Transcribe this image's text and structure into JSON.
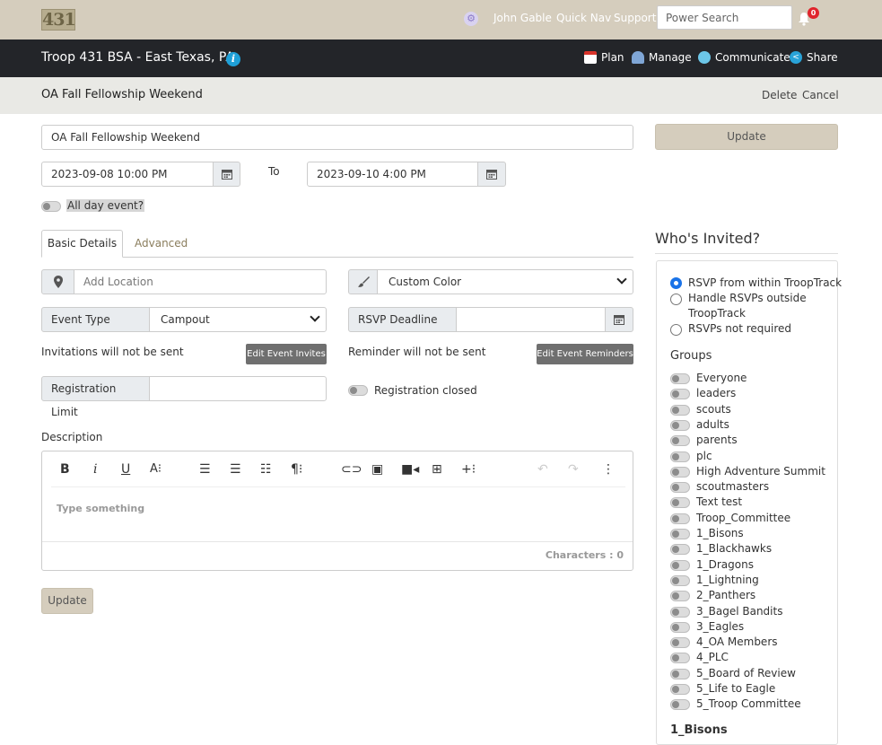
{
  "topbar": {
    "logo": "431",
    "user": "John Gable",
    "quick_nav": "Quick Nav",
    "support": "Support",
    "search_placeholder": "Power Search",
    "notifications_count": "0"
  },
  "troopbar": {
    "troop_name": "Troop 431 BSA - East Texas, PA",
    "nav": [
      {
        "label": "Plan",
        "icon": "calendar-icon"
      },
      {
        "label": "Manage",
        "icon": "people-icon"
      },
      {
        "label": "Communicate",
        "icon": "chat-icon"
      },
      {
        "label": "Share",
        "icon": "share-icon"
      }
    ]
  },
  "titlebar": {
    "title": "OA Fall Fellowship Weekend",
    "delete": "Delete",
    "cancel": "Cancel"
  },
  "form": {
    "event_name": "OA Fall Fellowship Weekend",
    "start": "2023-09-08 10:00 PM",
    "to_label": "To",
    "end": "2023-09-10 4:00 PM",
    "all_day_label": "All day event?",
    "update_label": "Update",
    "tabs": [
      "Basic Details",
      "Advanced"
    ],
    "location_placeholder": "Add Location",
    "color_value": "Custom Color",
    "event_type_label": "Event Type",
    "event_type_value": "Campout",
    "rsvp_deadline_label": "RSVP Deadline",
    "rsvp_deadline_value": "",
    "invites_status": "Invitations will not be sent",
    "edit_invites_label": "Edit Event Invites",
    "reminder_status": "Reminder will not be sent",
    "edit_reminders_label": "Edit Event Reminders",
    "registration_limit_label": "Registration Limit",
    "registration_limit_value": "",
    "registration_closed_label": "Registration closed",
    "description_label": "Description",
    "editor_placeholder": "Type something",
    "characters_label": "Characters : 0"
  },
  "invited": {
    "title": "Who's Invited?",
    "rsvp_options": [
      {
        "label": "RSVP from within TroopTrack",
        "checked": true
      },
      {
        "label": "Handle RSVPs outside TroopTrack",
        "checked": false
      },
      {
        "label": "RSVPs not required",
        "checked": false
      }
    ],
    "groups_title": "Groups",
    "groups": [
      "Everyone",
      "leaders",
      "scouts",
      "adults",
      "parents",
      "plc",
      "High Adventure Summit",
      "scoutmasters",
      "Text test",
      "Troop_Committee",
      "1_Bisons",
      "1_Blackhawks",
      "1_Dragons",
      "1_Lightning",
      "2_Panthers",
      "3_Bagel Bandits",
      "3_Eagles",
      "4_OA Members",
      "4_PLC",
      "5_Board of Review",
      "5_Life to Eagle",
      "5_Troop Committee"
    ],
    "next_section_title": "1_Bisons"
  }
}
